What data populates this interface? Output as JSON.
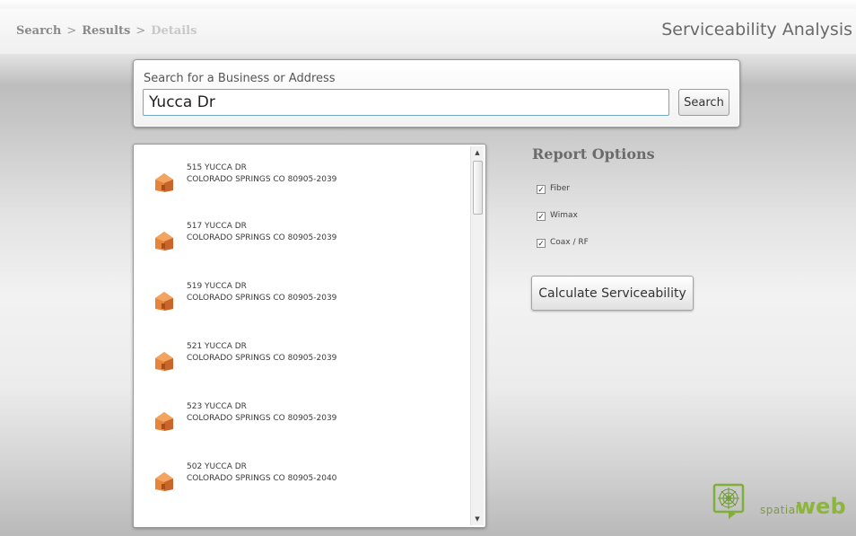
{
  "breadcrumb": {
    "items": [
      {
        "label": "Search",
        "state": "link"
      },
      {
        "label": "Results",
        "state": "link"
      },
      {
        "label": "Details",
        "state": "disabled"
      }
    ],
    "separator": ">"
  },
  "app": {
    "title": "Serviceability Analysis"
  },
  "search": {
    "label": "Search for a Business or Address",
    "value": "Yucca Dr",
    "button_label": "Search"
  },
  "results": [
    {
      "line1": "515 YUCCA DR",
      "line2": "COLORADO SPRINGS CO 80905-2039",
      "icon": "house-icon"
    },
    {
      "line1": "517 YUCCA DR",
      "line2": "COLORADO SPRINGS CO 80905-2039",
      "icon": "house-icon"
    },
    {
      "line1": "519 YUCCA DR",
      "line2": "COLORADO SPRINGS CO 80905-2039",
      "icon": "house-icon"
    },
    {
      "line1": "521 YUCCA DR",
      "line2": "COLORADO SPRINGS CO 80905-2039",
      "icon": "house-icon"
    },
    {
      "line1": "523 YUCCA DR",
      "line2": "COLORADO SPRINGS CO 80905-2039",
      "icon": "house-icon"
    },
    {
      "line1": "502 YUCCA DR",
      "line2": "COLORADO SPRINGS CO 80905-2040",
      "icon": "house-icon"
    }
  ],
  "report": {
    "title": "Report Options",
    "options": [
      {
        "label": "Fiber",
        "checked": true
      },
      {
        "label": "Wimax",
        "checked": true
      },
      {
        "label": "Coax / RF",
        "checked": true
      }
    ],
    "calculate_label": "Calculate Serviceability"
  },
  "brand": {
    "small": "spatial",
    "big": "web"
  },
  "colors": {
    "brand_green": "#8cb63a",
    "house_orange": "#e8843a",
    "input_border": "#6fa7c6"
  }
}
